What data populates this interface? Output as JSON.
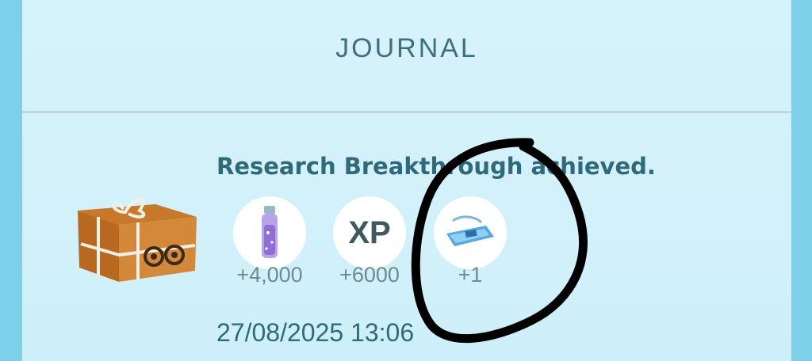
{
  "header": {
    "title": "JOURNAL"
  },
  "entry": {
    "icon": "research-breakthrough-box-icon",
    "headline": "Research Breakthrough achieved.",
    "rewards": [
      {
        "icon": "stardust-vial-icon",
        "amount": "+4,000"
      },
      {
        "icon": "xp-icon",
        "label": "XP",
        "amount": "+6000"
      },
      {
        "icon": "pass-item-icon",
        "amount": "+1"
      }
    ],
    "timestamp": "27/08/2025 13:06"
  },
  "colors": {
    "background": "#7ecfe9",
    "panel": "#d6f2fb",
    "accent_text": "#2e6a7a",
    "amount_text": "#6f8a90",
    "annotation": "#000000"
  }
}
